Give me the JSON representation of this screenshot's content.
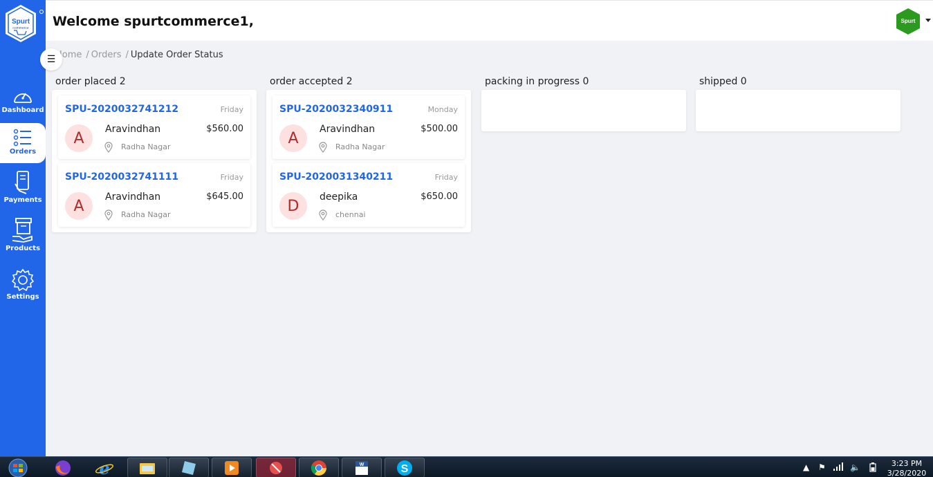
{
  "sidebar": {
    "logo_text": "Spurt",
    "logo_subtext": "commerce",
    "items": [
      {
        "label": "Dashboard",
        "icon": "gauge-icon"
      },
      {
        "label": "Orders",
        "icon": "list-icon"
      },
      {
        "label": "Payments",
        "icon": "card-hand-icon"
      },
      {
        "label": "Products",
        "icon": "box-hand-icon"
      },
      {
        "label": "Settings",
        "icon": "gear-icon"
      }
    ]
  },
  "header": {
    "welcome": "Welcome spurtcommerce1,",
    "avatar_text": "Spurt"
  },
  "breadcrumb": {
    "home": "Home",
    "orders": "Orders",
    "current": "Update Order Status"
  },
  "columns": [
    {
      "title": "order placed 2",
      "cards": [
        {
          "id": "SPU-2020032741212",
          "day": "Friday",
          "initial": "A",
          "name": "Aravindhan",
          "amount": "$560.00",
          "location": "Radha Nagar"
        },
        {
          "id": "SPU-2020032741111",
          "day": "Friday",
          "initial": "A",
          "name": "Aravindhan",
          "amount": "$645.00",
          "location": "Radha Nagar"
        }
      ]
    },
    {
      "title": "order accepted 2",
      "cards": [
        {
          "id": "SPU-2020032340911",
          "day": "Monday",
          "initial": "A",
          "name": "Aravindhan",
          "amount": "$500.00",
          "location": "Radha Nagar"
        },
        {
          "id": "SPU-2020031340211",
          "day": "Friday",
          "initial": "D",
          "name": "deepika",
          "amount": "$650.00",
          "location": "chennai"
        }
      ]
    },
    {
      "title": "packing in progress 0",
      "cards": []
    },
    {
      "title": "shipped 0",
      "cards": []
    }
  ],
  "taskbar": {
    "time": "3:23 PM",
    "date": "3/28/2020"
  },
  "colors": {
    "primary": "#2165e8",
    "avatar_bg": "#fde0e0",
    "avatar_fg": "#b22b2b"
  }
}
